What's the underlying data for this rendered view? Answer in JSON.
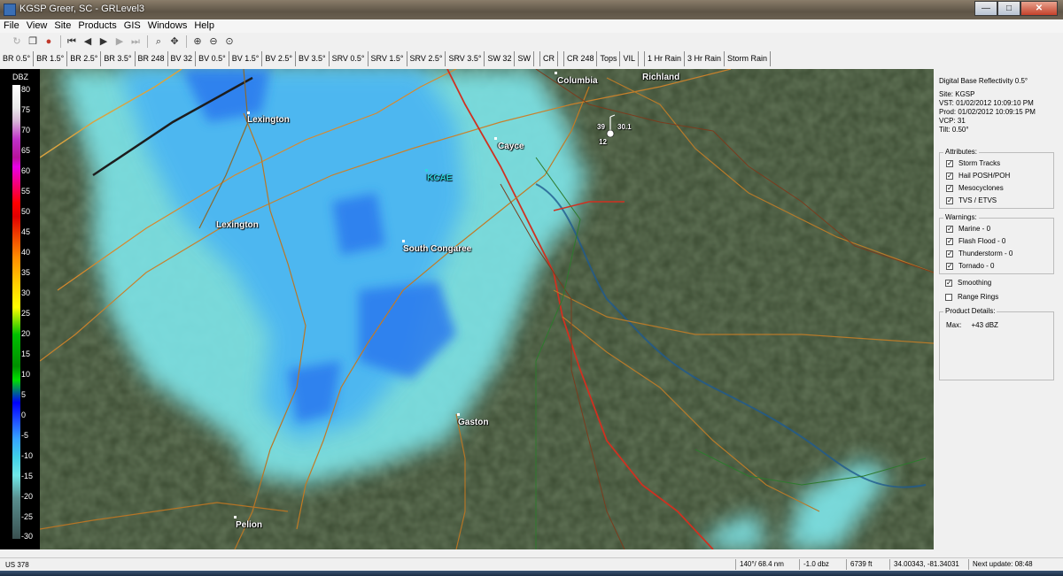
{
  "window": {
    "title": "KGSP Greer, SC - GRLevel3"
  },
  "menu": [
    "File",
    "View",
    "Site",
    "Products",
    "GIS",
    "Windows",
    "Help"
  ],
  "toolbar": [
    "refresh-icon",
    "copy-icon",
    "record-icon",
    "first-frame-icon",
    "prev-frame-icon",
    "play-icon",
    "next-frame-icon",
    "last-frame-icon",
    "zoom-icon",
    "pan-icon",
    "zoom-in-icon",
    "zoom-out-icon",
    "zoom-reset-icon"
  ],
  "products": [
    "BR 0.5°",
    "BR 1.5°",
    "BR 2.5°",
    "BR 3.5°",
    "BR 248",
    "BV 32",
    "BV 0.5°",
    "BV 1.5°",
    "BV 2.5°",
    "BV 3.5°",
    "SRV 0.5°",
    "SRV 1.5°",
    "SRV 2.5°",
    "SRV 3.5°",
    "SW 32",
    "SW",
    "CR",
    "CR 248",
    "Tops",
    "VIL",
    "1 Hr Rain",
    "3 Hr Rain",
    "Storm Rain"
  ],
  "scale": {
    "header": "DBZ",
    "ticks": [
      "80",
      "75",
      "70",
      "65",
      "60",
      "55",
      "50",
      "45",
      "40",
      "35",
      "30",
      "25",
      "20",
      "15",
      "10",
      "5",
      "0",
      "-5",
      "-10",
      "-15",
      "-20",
      "-25",
      "-30"
    ]
  },
  "map": {
    "labels": {
      "columbia": "Columbia",
      "richland": "Richland",
      "lexington_town": "Lexington",
      "lexington_county": "Lexington",
      "cayce": "Cayce",
      "kcae": "KCAE",
      "south_congaree": "South Congaree",
      "gaston": "Gaston",
      "pelion": "Pelion",
      "station_left": "39",
      "station_right": "30.1",
      "station_below": "12"
    }
  },
  "panel": {
    "title": "Digital Base Reflectivity 0.5°",
    "site": "Site: KGSP",
    "vst": "VST: 01/02/2012  10:09:10 PM",
    "prod": "Prod: 01/02/2012  10:09:15 PM",
    "vcp": "VCP: 31",
    "tilt": "Tilt: 0.50°",
    "attributes_title": "Attributes:",
    "attributes": [
      "Storm Tracks",
      "Hail POSH/POH",
      "Mesocyclones",
      "TVS / ETVS"
    ],
    "warnings_title": "Warnings:",
    "warnings": [
      "Marine - 0",
      "Flash Flood - 0",
      "Thunderstorm - 0",
      "Tornado - 0"
    ],
    "smoothing": "Smoothing",
    "range_rings": "Range Rings",
    "details_title": "Product Details:",
    "details_max": "Max:     +43 dBZ"
  },
  "status": {
    "left": "US 378",
    "azimuth": "140°/ 68.4 nm",
    "dbz": "-1.0 dbz",
    "height": "6739 ft",
    "coords": "34.00343, -81.34031",
    "next_update": "Next update: 08:48"
  }
}
